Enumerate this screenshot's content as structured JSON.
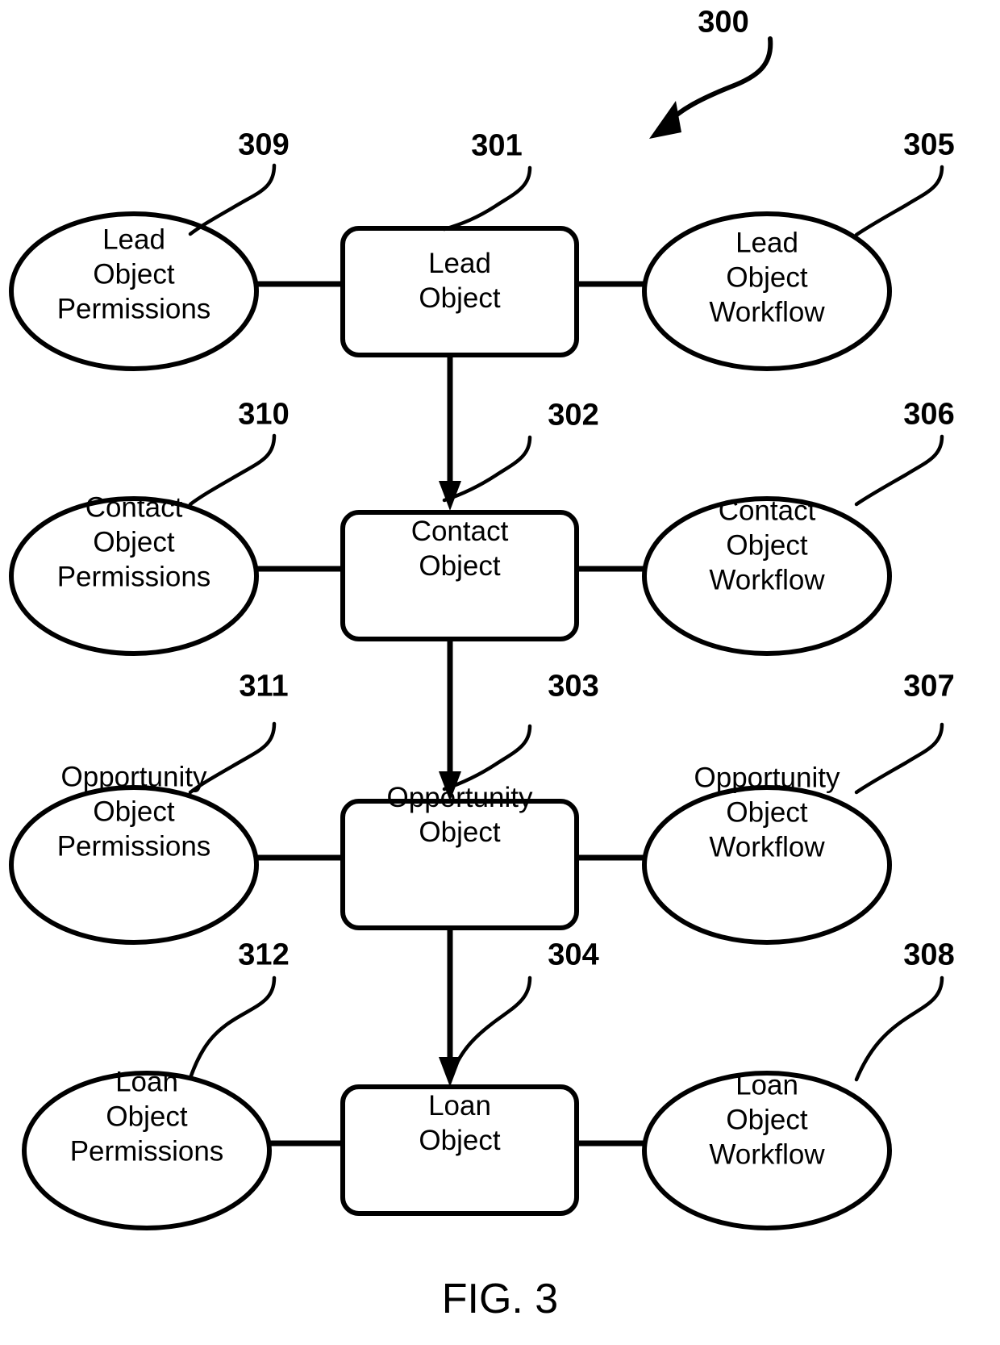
{
  "figure": {
    "caption": "FIG. 3",
    "figure_ref": "300"
  },
  "rows": [
    {
      "center": {
        "ref": "301",
        "label": "Lead\nObject"
      },
      "left": {
        "ref": "309",
        "label": "Lead\nObject\nPermissions"
      },
      "right": {
        "ref": "305",
        "label": "Lead\nObject\nWorkflow"
      }
    },
    {
      "center": {
        "ref": "302",
        "label": "Contact\nObject"
      },
      "left": {
        "ref": "310",
        "label": "Contact\nObject\nPermissions"
      },
      "right": {
        "ref": "306",
        "label": "Contact\nObject\nWorkflow"
      }
    },
    {
      "center": {
        "ref": "303",
        "label": "Opportunity\nObject"
      },
      "left": {
        "ref": "311",
        "label": "Opportunity\nObject\nPermissions"
      },
      "right": {
        "ref": "307",
        "label": "Opportunity\nObject\nWorkflow"
      }
    },
    {
      "center": {
        "ref": "304",
        "label": "Loan\nObject"
      },
      "left": {
        "ref": "312",
        "label": "Loan\nObject\nPermissions"
      },
      "right": {
        "ref": "308",
        "label": "Loan\nObject\nWorkflow"
      }
    }
  ],
  "colors": {
    "stroke": "#000000",
    "fill": "#ffffff",
    "text": "#000000"
  }
}
